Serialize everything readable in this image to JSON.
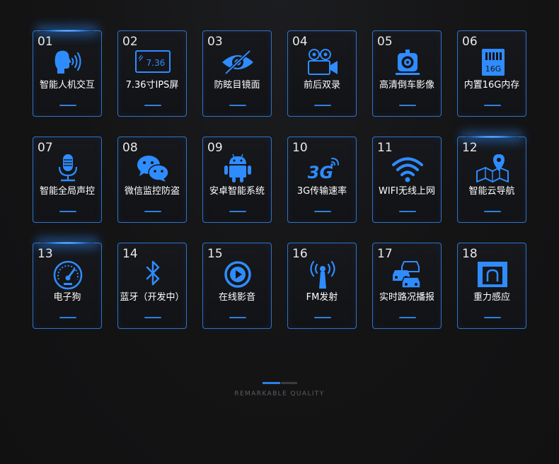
{
  "accent": "#2d73c9",
  "icon_color": "#2f8cff",
  "cards": [
    {
      "num": "01",
      "label": "智能人机交互",
      "icon": "voice-head-icon"
    },
    {
      "num": "02",
      "label": "7.36寸IPS屏",
      "icon": "screen-icon",
      "screen_text": "7.36"
    },
    {
      "num": "03",
      "label": "防眩目镜面",
      "icon": "anti-glare-eye-icon"
    },
    {
      "num": "04",
      "label": "前后双录",
      "icon": "video-camera-icon"
    },
    {
      "num": "05",
      "label": "高清倒车影像",
      "icon": "rear-camera-icon"
    },
    {
      "num": "06",
      "label": "内置16G内存",
      "icon": "memory-card-icon",
      "card_text": "16G"
    },
    {
      "num": "07",
      "label": "智能全局声控",
      "icon": "microphone-icon"
    },
    {
      "num": "08",
      "label": "微信监控防盗",
      "icon": "wechat-icon"
    },
    {
      "num": "09",
      "label": "安卓智能系统",
      "icon": "android-icon"
    },
    {
      "num": "10",
      "label": "3G传输速率",
      "icon": "3g-icon",
      "icon_text": "3G"
    },
    {
      "num": "11",
      "label": "WIFI无线上网",
      "icon": "wifi-icon"
    },
    {
      "num": "12",
      "label": "智能云导航",
      "icon": "map-pin-icon"
    },
    {
      "num": "13",
      "label": "电子狗",
      "icon": "speedometer-icon"
    },
    {
      "num": "14",
      "label": "蓝牙（开发中）",
      "icon": "bluetooth-icon"
    },
    {
      "num": "15",
      "label": "在线影音",
      "icon": "play-icon"
    },
    {
      "num": "16",
      "label": "FM发射",
      "icon": "fm-antenna-icon"
    },
    {
      "num": "17",
      "label": "实时路况播报",
      "icon": "traffic-cars-icon"
    },
    {
      "num": "18",
      "label": "重力感应",
      "icon": "gravity-sensor-icon"
    }
  ],
  "footer": {
    "tagline": "REMARKABLE QUALITY"
  }
}
